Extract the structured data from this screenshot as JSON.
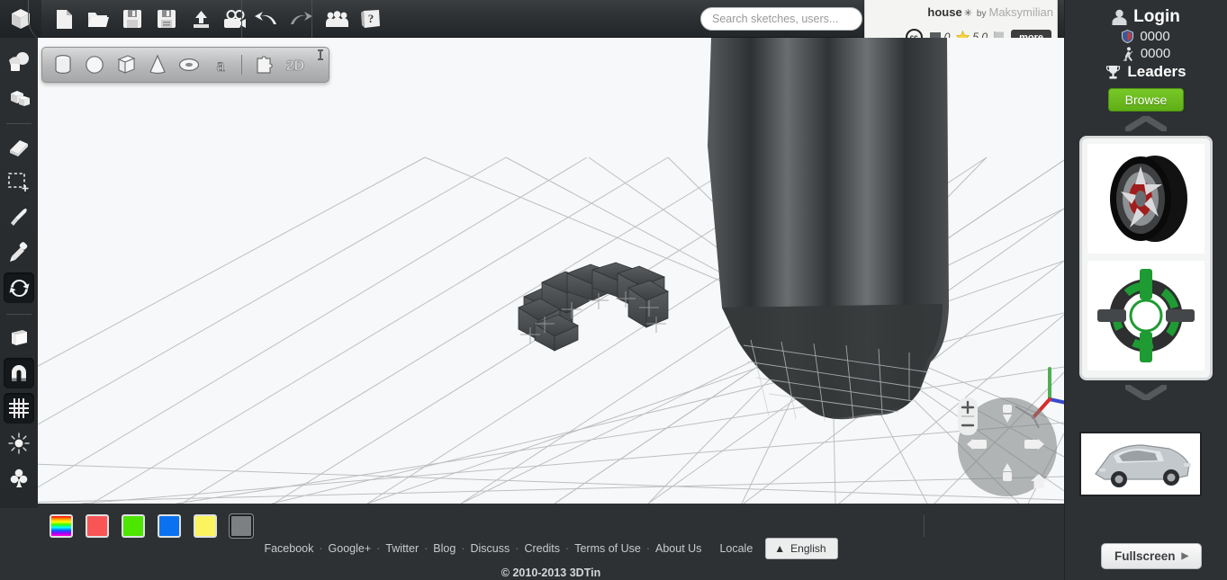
{
  "app": {
    "name": "3DTin",
    "logo_icon": "cube-logo-icon"
  },
  "toolbar": {
    "file_tools": [
      {
        "name": "new-sketch-button",
        "icon": "new-file-icon",
        "label": "New"
      },
      {
        "name": "open-sketch-button",
        "icon": "open-folder-icon",
        "label": "Open"
      },
      {
        "name": "save-button",
        "icon": "floppy-save-icon",
        "label": "Save"
      },
      {
        "name": "save-as-button",
        "icon": "floppy-save-as-icon",
        "label": "Save As"
      },
      {
        "name": "export-button",
        "icon": "upload-arrow-icon",
        "label": "Export"
      },
      {
        "name": "record-button",
        "icon": "movie-camera-icon",
        "label": "Record"
      }
    ],
    "history_tools": [
      {
        "name": "undo-button",
        "icon": "undo-arrow-icon",
        "label": "Undo"
      },
      {
        "name": "redo-button",
        "icon": "redo-arrow-icon",
        "label": "Redo"
      }
    ],
    "social_tools": [
      {
        "name": "community-button",
        "icon": "people-group-icon",
        "label": "Community"
      },
      {
        "name": "help-button",
        "icon": "help-book-icon",
        "label": "Help"
      }
    ]
  },
  "search": {
    "placeholder": "Search sketches, users...",
    "value": "",
    "icon": "search-icon"
  },
  "info_panel": {
    "sketch_name": "house",
    "star_mark": "✳",
    "by_label": "by",
    "author": "Maksymilian",
    "license_icon": "creative-commons-icon",
    "license_label": "cc",
    "comments_icon": "comment-bubble-icon",
    "comments_count": "0",
    "rating_icon": "star-icon",
    "rating_value": "5.0",
    "flag_icon": "flag-icon",
    "more_label": "more"
  },
  "left_rail": {
    "tools": [
      {
        "name": "add-shape-tool",
        "icon": "union-shapes-icon",
        "active": false
      },
      {
        "name": "stack-blocks-tool",
        "icon": "stacked-cubes-icon",
        "active": false
      },
      {
        "name": "eraser-tool",
        "icon": "eraser-icon",
        "active": false
      },
      {
        "name": "select-region-tool",
        "icon": "marquee-select-icon",
        "active": false
      },
      {
        "name": "paint-brush-tool",
        "icon": "paint-brush-icon",
        "active": false
      },
      {
        "name": "color-picker-tool",
        "icon": "eyedropper-icon",
        "active": false
      },
      {
        "name": "rotate-refresh-tool",
        "icon": "refresh-rotate-icon",
        "active": true
      },
      {
        "name": "box-view-tool",
        "icon": "open-box-icon",
        "active": false
      },
      {
        "name": "snap-magnet-tool",
        "icon": "magnet-icon",
        "active": true
      },
      {
        "name": "grid-toggle-tool",
        "icon": "grid-icon",
        "active": true
      },
      {
        "name": "brightness-tool",
        "icon": "sun-brightness-icon",
        "active": false
      },
      {
        "name": "clover-tool",
        "icon": "clover-icon",
        "active": false
      }
    ]
  },
  "shape_bar": {
    "shapes": [
      {
        "name": "cylinder-shape-button",
        "icon": "cylinder-icon"
      },
      {
        "name": "sphere-shape-button",
        "icon": "sphere-icon"
      },
      {
        "name": "box-shape-button",
        "icon": "box-icon"
      },
      {
        "name": "cone-shape-button",
        "icon": "cone-icon"
      },
      {
        "name": "torus-shape-button",
        "icon": "torus-icon"
      },
      {
        "name": "text-shape-button",
        "icon": "text-a-icon",
        "label": "a"
      }
    ],
    "extras": [
      {
        "name": "plugin-button",
        "icon": "puzzle-piece-icon"
      },
      {
        "name": "two-d-mode-button",
        "icon": "2d-badge-icon",
        "label": "2D"
      }
    ],
    "pin": {
      "name": "pin-toolbar-button",
      "icon": "pin-icon"
    }
  },
  "canvas": {
    "nav": {
      "up": "camera-up-button",
      "down": "camera-down-button",
      "left": "camera-left-button",
      "right": "camera-right-button",
      "zoom_in": "+",
      "zoom_out": "−",
      "home": "reset-view-button"
    },
    "axis": {
      "x_color": "#d32f2f",
      "y_color": "#4caf50",
      "z_color": "#3949cc"
    },
    "grid_color": "#b9bcbe",
    "background": "#f7f8f9",
    "objects": [
      {
        "name": "voxel-arch-model",
        "color": "#4a4d4f"
      },
      {
        "name": "large-dark-model",
        "color": "#3b3e40"
      }
    ]
  },
  "palette": {
    "swatches": [
      {
        "name": "color-swatch-rainbow",
        "value": "rainbow",
        "selected": false
      },
      {
        "name": "color-swatch-red",
        "value": "#f95555",
        "selected": false
      },
      {
        "name": "color-swatch-green",
        "value": "#4ce600",
        "selected": false
      },
      {
        "name": "color-swatch-blue",
        "value": "#0a72f0",
        "selected": false
      },
      {
        "name": "color-swatch-yellow",
        "value": "#fcf45e",
        "selected": false
      },
      {
        "name": "color-swatch-gray",
        "value": "#7d8083",
        "selected": true
      }
    ]
  },
  "footer": {
    "links": [
      "Facebook",
      "Google+",
      "Twitter",
      "Blog",
      "Discuss",
      "Credits",
      "Terms of Use",
      "About Us"
    ],
    "locale_label": "Locale",
    "locale_value": "English",
    "locale_arrow": "▲",
    "copyright": "© 2010-2013 3DTin"
  },
  "sidebar": {
    "login_label": "Login",
    "login_icon": "user-person-icon",
    "shield_icon": "shield-icon",
    "shield_count": "0000",
    "runner_icon": "runner-figure-icon",
    "runner_count": "0000",
    "trophy_icon": "trophy-icon",
    "leaders_label": "Leaders",
    "browse_label": "Browse",
    "chevron_up_icon": "chevron-up-icon",
    "chevron_down_icon": "chevron-down-icon",
    "gallery": [
      {
        "name": "gallery-thumb-wheel",
        "title": "car wheel rim"
      },
      {
        "name": "gallery-thumb-gear",
        "title": "green gear assembly"
      }
    ],
    "promo": {
      "name": "promo-thumb-car",
      "title": "silver sports car"
    },
    "fullscreen_label": "Fullscreen",
    "fullscreen_arrow": "▶"
  }
}
